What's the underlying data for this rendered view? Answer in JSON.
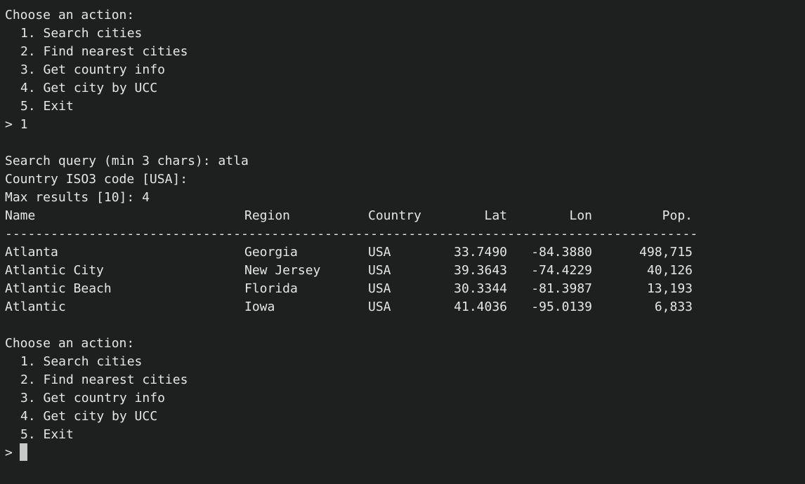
{
  "menu1": {
    "title": "Choose an action:",
    "items": [
      "1. Search cities",
      "2. Find nearest cities",
      "3. Get country info",
      "4. Get city by UCC",
      "5. Exit"
    ],
    "prompt": "> 1"
  },
  "search": {
    "query_line": "Search query (min 3 chars): atla",
    "country_line": "Country ISO3 code [USA]:",
    "max_line": "Max results [10]: 4"
  },
  "table": {
    "headers": {
      "name": "Name",
      "region": "Region",
      "country": "Country",
      "lat": "Lat",
      "lon": "Lon",
      "pop": "Pop."
    },
    "separator": "-------------------------------------------------------------------------------------------",
    "rows": [
      {
        "name": "Atlanta",
        "region": "Georgia",
        "country": "USA",
        "lat": "33.7490",
        "lon": "-84.3880",
        "pop": "498,715"
      },
      {
        "name": "Atlantic City",
        "region": "New Jersey",
        "country": "USA",
        "lat": "39.3643",
        "lon": "-74.4229",
        "pop": "40,126"
      },
      {
        "name": "Atlantic Beach",
        "region": "Florida",
        "country": "USA",
        "lat": "30.3344",
        "lon": "-81.3987",
        "pop": "13,193"
      },
      {
        "name": "Atlantic",
        "region": "Iowa",
        "country": "USA",
        "lat": "41.4036",
        "lon": "-95.0139",
        "pop": "6,833"
      }
    ]
  },
  "menu2": {
    "title": "Choose an action:",
    "items": [
      "1. Search cities",
      "2. Find nearest cities",
      "3. Get country info",
      "4. Get city by UCC",
      "5. Exit"
    ],
    "prompt": ">"
  },
  "colors": {
    "background": "#1e1f1f",
    "text": "#e6e6e6",
    "cursor": "#c8c8c8"
  }
}
